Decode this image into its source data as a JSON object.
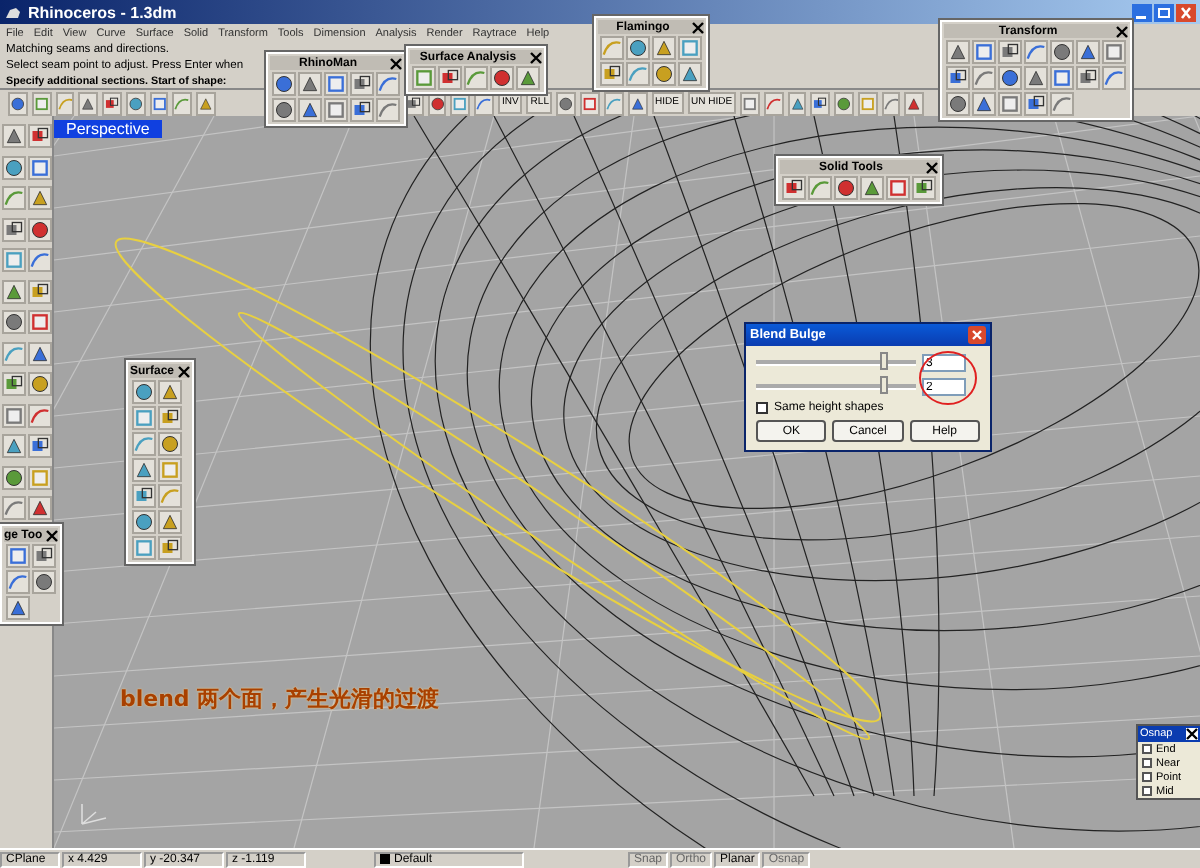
{
  "window": {
    "title": "Rhinoceros - 1.3dm"
  },
  "menu": [
    "File",
    "Edit",
    "View",
    "Curve",
    "Surface",
    "Solid",
    "Transform",
    "Tools",
    "Dimension",
    "Analysis",
    "Render",
    "Raytrace",
    "Help"
  ],
  "command_history": [
    "Matching seams and directions.",
    "Select seam point to adjust. Press Enter when"
  ],
  "command_prompt": "Specify additional sections. Start of shape:",
  "toolbar_labels": [
    "INV",
    "RLL",
    "HIDE",
    "UN HIDE"
  ],
  "viewport": {
    "title": "Perspective"
  },
  "palettes": [
    {
      "title": "RhinoMan"
    },
    {
      "title": "Surface Analysis"
    },
    {
      "title": "Flamingo"
    },
    {
      "title": "Transform"
    },
    {
      "title": "Solid Tools"
    },
    {
      "title": "Surface"
    },
    {
      "title": "ge Too"
    }
  ],
  "dialog": {
    "title": "Blend Bulge",
    "sliders": [
      {
        "level": 0.8,
        "value": "3"
      },
      {
        "level": 0.8,
        "value": "2"
      }
    ],
    "checkbox": {
      "label": "Same height shapes",
      "checked": false
    },
    "buttons": [
      "OK",
      "Cancel",
      "Help"
    ]
  },
  "annotation": "blend 两个面，产生光滑的过渡",
  "osnap": {
    "title": "Osnap",
    "items": [
      {
        "label": "End",
        "checked": false
      },
      {
        "label": "Near",
        "checked": false
      },
      {
        "label": "Point",
        "checked": false
      },
      {
        "label": "Mid",
        "checked": false
      }
    ]
  },
  "status_bar": {
    "cplane": "CPlane",
    "x": "x 4.429",
    "y": "y -20.347",
    "z": "z -1.119",
    "layer": "Default",
    "toggles": [
      {
        "label": "Snap",
        "on": false
      },
      {
        "label": "Ortho",
        "on": false
      },
      {
        "label": "Planar",
        "on": true
      },
      {
        "label": "Osnap",
        "on": false
      }
    ]
  }
}
